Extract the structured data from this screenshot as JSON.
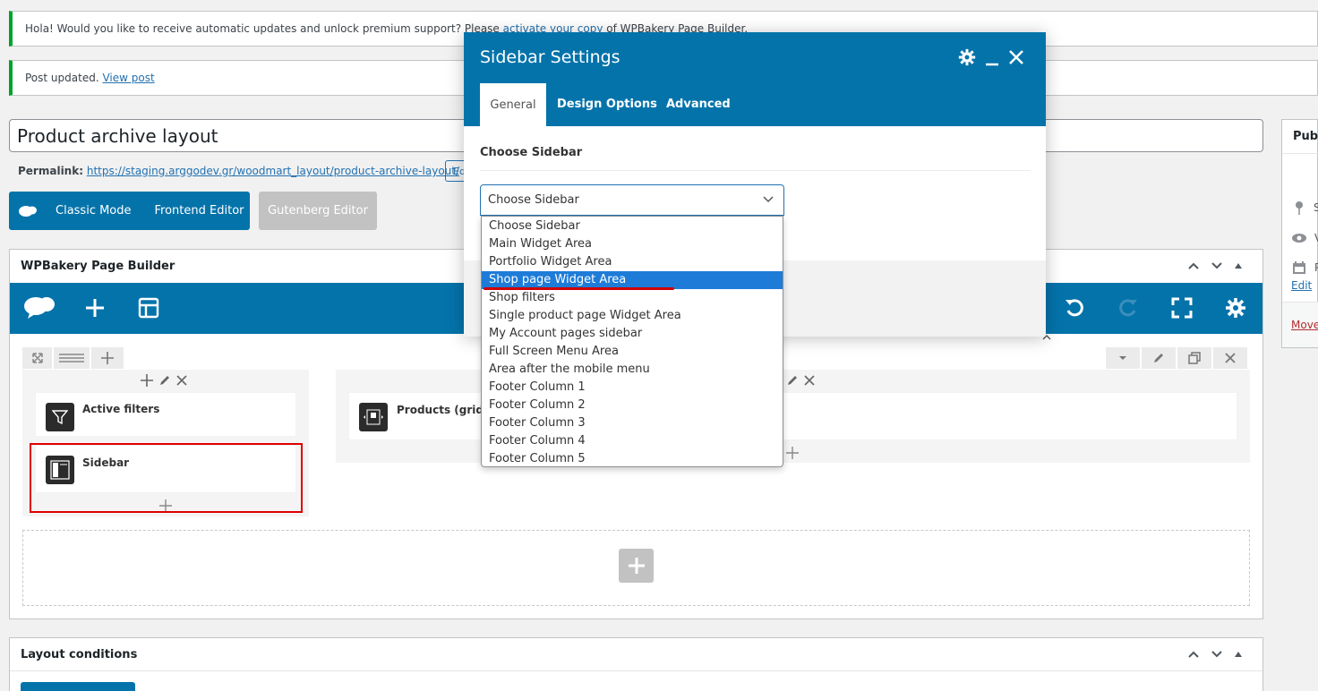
{
  "notices": {
    "update_text": "Hola! Would you like to receive automatic updates and unlock premium support? Please",
    "update_link": "activate your copy",
    "update_suffix": "of WPBakery Page Builder.",
    "post_updated": "Post updated.",
    "view_post": "View post"
  },
  "post": {
    "title": "Product archive layout",
    "permalink_label": "Permalink:",
    "permalink_url": "https://staging.arggodev.gr/woodmart_layout/product-archive-layout/",
    "edit_button": "Edit"
  },
  "editor_buttons": {
    "classic": "Classic Mode",
    "frontend": "Frontend Editor",
    "gutenberg": "Gutenberg Editor"
  },
  "builder": {
    "title": "WPBakery Page Builder",
    "left_column": {
      "elements": [
        {
          "label": "Active filters",
          "icon": "filter-icon"
        },
        {
          "label": "Sidebar",
          "icon": "sidebar-layout-icon"
        }
      ]
    },
    "right_column": {
      "elements": [
        {
          "label": "Products (grid o",
          "icon": "products-grid-icon"
        }
      ]
    }
  },
  "layout_conditions": {
    "title": "Layout conditions"
  },
  "publish_box": {
    "title": "Publi",
    "rows": [
      "S",
      "V",
      "P"
    ],
    "edit": "Edit",
    "move": "Move"
  },
  "modal": {
    "title": "Sidebar Settings",
    "tabs": [
      {
        "label": "General",
        "active": true
      },
      {
        "label": "Design Options",
        "active": false
      },
      {
        "label": "Advanced",
        "active": false
      }
    ],
    "field_label": "Choose Sidebar",
    "select_value": "Choose Sidebar",
    "options": [
      "Choose Sidebar",
      "Main Widget Area",
      "Portfolio Widget Area",
      "Shop page Widget Area",
      "Shop filters",
      "Single product page Widget Area",
      "My Account pages sidebar",
      "Full Screen Menu Area",
      "Area after the mobile menu",
      "Footer Column 1",
      "Footer Column 2",
      "Footer Column 3",
      "Footer Column 4",
      "Footer Column 5"
    ],
    "highlighted_option": "Shop page Widget Area"
  },
  "colors": {
    "brand_blue": "#0473aa",
    "highlight_blue": "#1e7cd8",
    "annotation_red": "#e00000"
  }
}
